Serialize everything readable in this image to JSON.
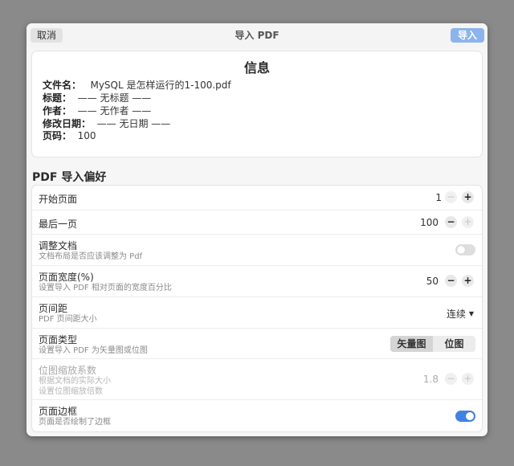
{
  "header": {
    "cancel_label": "取消",
    "title": "导入 PDF",
    "import_label": "导入"
  },
  "info": {
    "title": "信息",
    "rows": [
      {
        "label": "文件名：",
        "value": "MySQL 是怎样运行的1-100.pdf"
      },
      {
        "label": "标题：",
        "value": "—— 无标题 ——"
      },
      {
        "label": "作者：",
        "value": "—— 无作者 ——"
      },
      {
        "label": "修改日期：",
        "value": "—— 无日期 ——"
      },
      {
        "label": "页码：",
        "value": "100"
      }
    ]
  },
  "prefs": {
    "section_title": "PDF 导入偏好",
    "start_page": {
      "label": "开始页面",
      "value": "1"
    },
    "last_page": {
      "label": "最后一页",
      "value": "100"
    },
    "adjust_doc": {
      "label": "调整文档",
      "sub": "文档布局是否应该调整为 Pdf",
      "enabled": false
    },
    "page_width": {
      "label": "页面宽度(%)",
      "sub": "设置导入 PDF 相对页面的宽度百分比",
      "value": "50"
    },
    "page_spacing": {
      "label": "页间距",
      "sub": "PDF 页间距大小",
      "value": "连续"
    },
    "page_type": {
      "label": "页面类型",
      "sub": "设置导入 PDF 为矢量图或位图",
      "options": [
        "矢量图",
        "位图"
      ],
      "selected": "矢量图"
    },
    "bitmap_scale": {
      "label": "位图缩放系数",
      "sub1": "根据文档的实际大小",
      "sub2": "设置位图缩放倍数",
      "value": "1.8"
    },
    "page_border": {
      "label": "页面边框",
      "sub": "页面是否绘制了边框",
      "enabled": true
    }
  },
  "colors": {
    "accent": "#3f82e4",
    "import_button": "#8cb4ec",
    "background": "#8a8a8a"
  },
  "icons": {
    "minus": "minus-icon",
    "plus": "plus-icon",
    "dropdown": "caret-down-icon"
  }
}
